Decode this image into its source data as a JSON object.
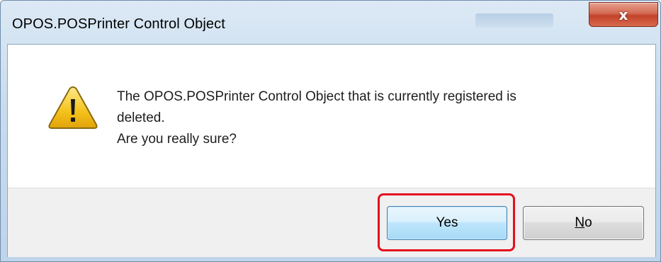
{
  "window": {
    "title": "OPOS.POSPrinter Control Object",
    "close_glyph": "x",
    "close_icon": "close-icon"
  },
  "dialog": {
    "icon": "warning-icon",
    "message_lines": [
      "The OPOS.POSPrinter Control Object that is currently registered is",
      "deleted.",
      "Are you really sure?"
    ]
  },
  "buttons": {
    "yes_label": "Yes",
    "no_label": "No",
    "no_mnemonic": "N",
    "no_rest": "o"
  },
  "colors": {
    "highlight": "#e4101e",
    "warning_fill": "#f5c21b",
    "titlebar": "#c9dcee"
  }
}
